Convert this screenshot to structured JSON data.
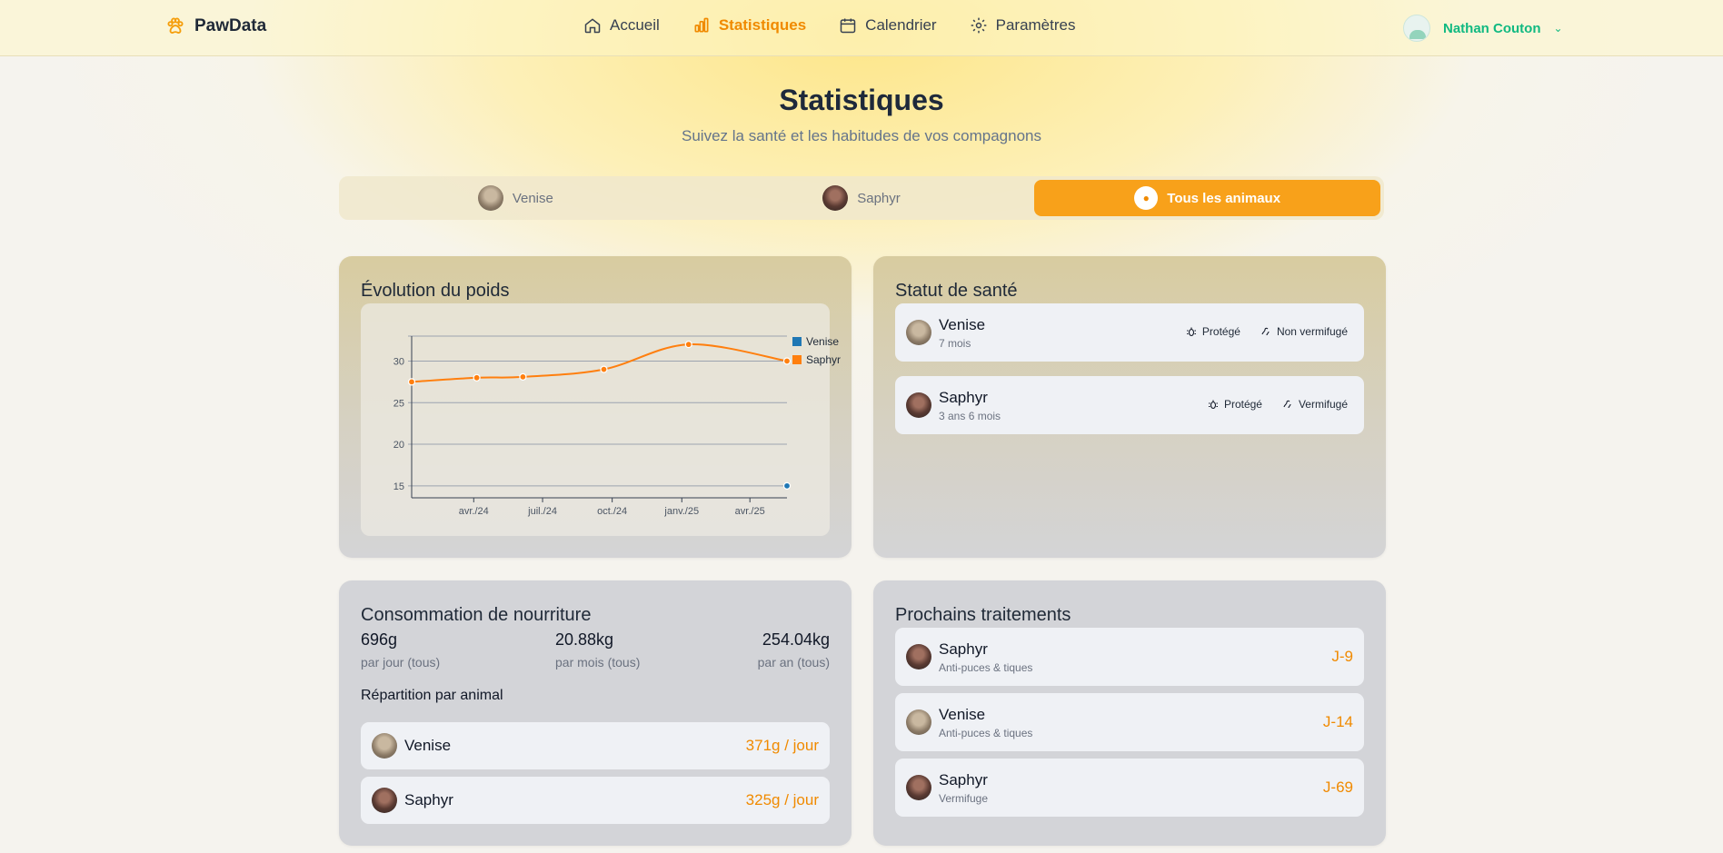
{
  "app": {
    "name": "PawData"
  },
  "nav": {
    "items": [
      {
        "label": "Accueil",
        "icon": "home-icon"
      },
      {
        "label": "Statistiques",
        "icon": "bar-chart-icon",
        "active": true
      },
      {
        "label": "Calendrier",
        "icon": "calendar-icon"
      },
      {
        "label": "Paramètres",
        "icon": "gear-icon"
      }
    ]
  },
  "user": {
    "name": "Nathan Couton"
  },
  "page": {
    "title": "Statistiques",
    "subtitle": "Suivez la santé et les habitudes de vos compagnons"
  },
  "tabs": [
    {
      "label": "Venise"
    },
    {
      "label": "Saphyr"
    },
    {
      "label": "Tous les animaux",
      "active": true
    }
  ],
  "weight_card": {
    "title": "Évolution du poids"
  },
  "chart_data": {
    "type": "line",
    "title": "",
    "xlabel": "",
    "ylabel": "",
    "x_ticks": [
      "avr./24",
      "juil./24",
      "oct./24",
      "janv./25",
      "avr./25"
    ],
    "y_ticks": [
      15,
      20,
      25,
      30
    ],
    "ylim": [
      14,
      33
    ],
    "legend_position": "top-right",
    "series": [
      {
        "name": "Venise",
        "color": "#1f77b4",
        "points": [
          {
            "x": "2025-05-20",
            "y": 15
          }
        ]
      },
      {
        "name": "Saphyr",
        "color": "#ff7f0e",
        "points": [
          {
            "x": "2024-01-10",
            "y": 27.5
          },
          {
            "x": "2024-04-05",
            "y": 28.0
          },
          {
            "x": "2024-06-05",
            "y": 28.1
          },
          {
            "x": "2024-09-20",
            "y": 29.0
          },
          {
            "x": "2025-01-10",
            "y": 32.0
          },
          {
            "x": "2025-05-20",
            "y": 30.0
          }
        ]
      }
    ]
  },
  "health_card": {
    "title": "Statut de santé",
    "items": [
      {
        "name": "Venise",
        "age": "7 mois",
        "badge1": "Protégé",
        "badge2": "Non vermifugé"
      },
      {
        "name": "Saphyr",
        "age": "3 ans 6 mois",
        "badge1": "Protégé",
        "badge2": "Vermifugé"
      }
    ]
  },
  "food_card": {
    "title": "Consommation de nourriture",
    "stats": [
      {
        "value": "696g",
        "label": "par jour (tous)"
      },
      {
        "value": "20.88kg",
        "label": "par mois (tous)"
      },
      {
        "value": "254.04kg",
        "label": "par an (tous)"
      }
    ],
    "breakdown_title": "Répartition par animal",
    "rows": [
      {
        "name": "Venise",
        "value": "371g / jour"
      },
      {
        "name": "Saphyr",
        "value": "325g / jour"
      }
    ]
  },
  "treatments_card": {
    "title": "Prochains traitements",
    "rows": [
      {
        "name": "Saphyr",
        "type": "Anti-puces & tiques",
        "due": "J-9"
      },
      {
        "name": "Venise",
        "type": "Anti-puces & tiques",
        "due": "J-14"
      },
      {
        "name": "Saphyr",
        "type": "Vermifuge",
        "due": "J-69"
      }
    ]
  }
}
